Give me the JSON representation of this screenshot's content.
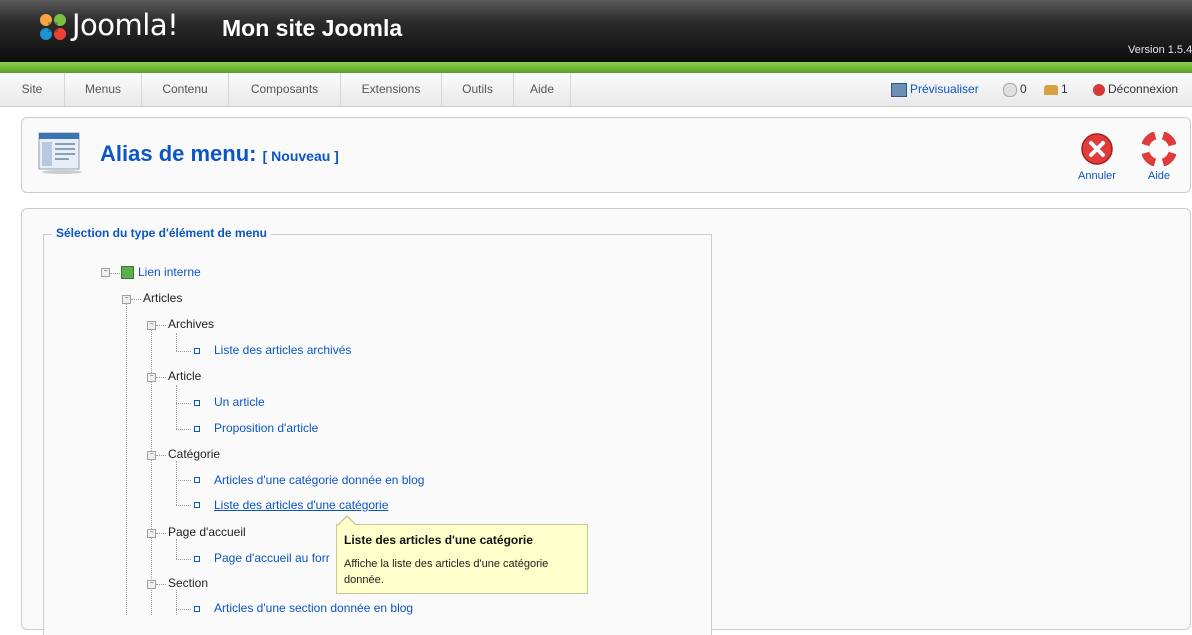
{
  "header": {
    "logo_text": "Joomla!",
    "site_name": "Mon site Joomla",
    "version": "Version 1.5.4"
  },
  "menubar": {
    "items": [
      "Site",
      "Menus",
      "Contenu",
      "Composants",
      "Extensions",
      "Outils",
      "Aide"
    ],
    "preview": "Prévisualiser",
    "messages_count": "0",
    "users_count": "1",
    "logout": "Déconnexion"
  },
  "toolbar": {
    "title": "Alias de menu:",
    "subtitle": "[ Nouveau ]",
    "cancel_label": "Annuler",
    "help_label": "Aide"
  },
  "section": {
    "legend": "Sélection du type d'élément de menu"
  },
  "tree": {
    "internal_link": "Lien interne",
    "articles": "Articles",
    "archives": "Archives",
    "archives_list": "Liste des articles archivés",
    "article": "Article",
    "an_article": "Un article",
    "article_submit": "Proposition d'article",
    "category": "Catégorie",
    "category_blog": "Articles d'une catégorie donnée en blog",
    "category_list": "Liste des articles d'une catégorie",
    "frontpage": "Page d'accueil",
    "frontpage_layout": "Page d'accueil au forr",
    "section": "Section",
    "section_blog": "Articles d'une section donnée en blog"
  },
  "tooltip": {
    "title": "Liste des articles d'une catégorie",
    "body": "Affiche la liste des articles d'une catégorie donnée."
  },
  "colors": {
    "link": "#0b55c4",
    "header_green": "#6fb536",
    "tooltip_bg": "#ffffcc"
  }
}
